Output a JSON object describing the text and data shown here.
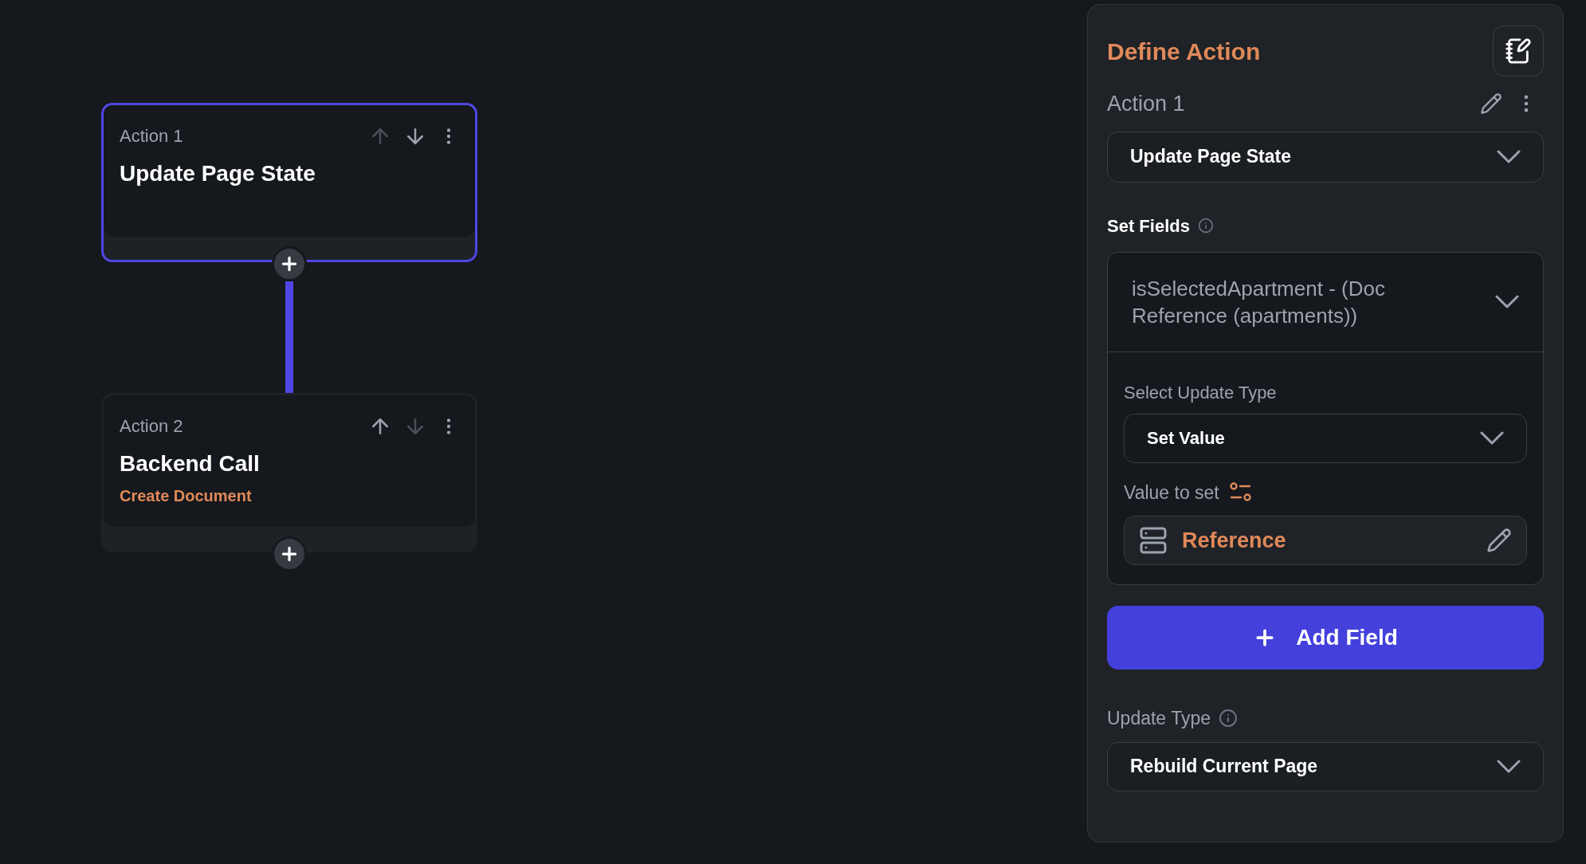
{
  "actions": [
    {
      "label": "Action 1",
      "title": "Update Page State",
      "selected": true,
      "can_move_up": false,
      "can_move_down": true
    },
    {
      "label": "Action 2",
      "title": "Backend Call",
      "subtitle": "Create Document",
      "selected": false,
      "can_move_up": true,
      "can_move_down": false
    }
  ],
  "panel": {
    "title": "Define Action",
    "action_name": "Action 1",
    "action_type": "Update Page State",
    "set_fields_label": "Set Fields",
    "field": {
      "name": "isSelectedApartment - (Doc Reference (apartments))",
      "expanded": true,
      "update_type_label": "Select Update Type",
      "update_type": "Set Value",
      "value_label": "Value to set",
      "value": "Reference"
    },
    "add_button": "Add Field",
    "update_type_label": "Update Type",
    "update_type": "Rebuild Current Page"
  }
}
